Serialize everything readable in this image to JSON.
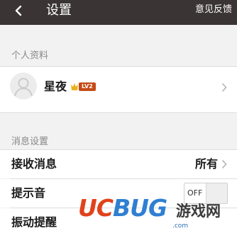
{
  "header": {
    "title": "设置",
    "feedback_label": "意见反馈"
  },
  "profile_section": {
    "header": "个人资料",
    "nickname": "星夜",
    "level": "LV2"
  },
  "message_section": {
    "header": "消息设置",
    "receive_label": "接收消息",
    "receive_value": "所有",
    "sound_label": "提示音",
    "sound_toggle": "OFF",
    "vibrate_label": "振动提醒"
  },
  "watermark": {
    "logo_uc": "UC",
    "logo_bug": "BUG",
    "cn_text": "游戏网",
    "url": ".com"
  },
  "colors": {
    "header_bg": "#3b3434",
    "badge": "#c54a16",
    "crown": "#e8b21c"
  },
  "icons": [
    "back-arrow-icon",
    "avatar-placeholder-icon",
    "crown-icon",
    "chevron-right-icon"
  ]
}
